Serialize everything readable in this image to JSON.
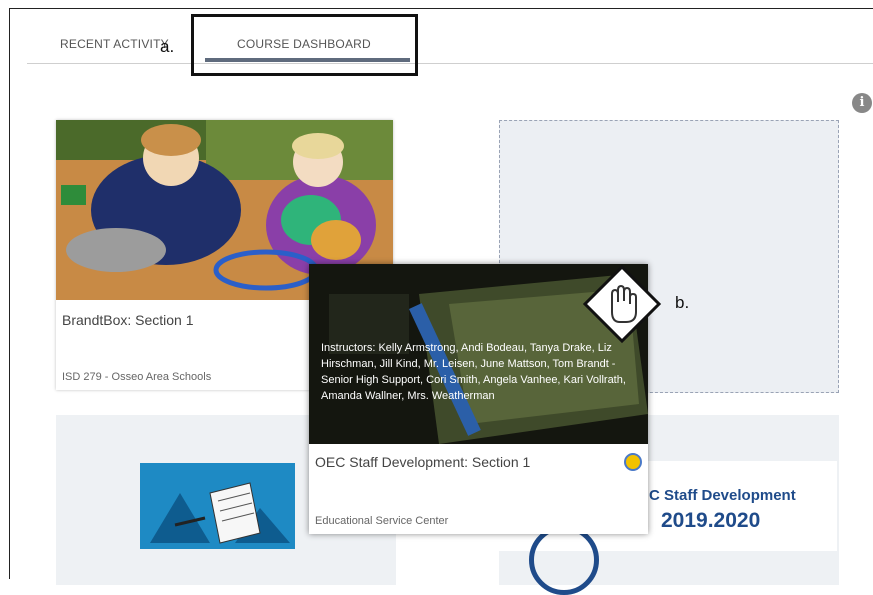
{
  "tabs": {
    "recent_activity": "RECENT ACTIVITY",
    "course_dashboard": "COURSE DASHBOARD"
  },
  "annotations": {
    "a": "a.",
    "b": "b."
  },
  "info_icon": {
    "glyph": "i",
    "icon": "info-icon"
  },
  "cards": {
    "brandtbox": {
      "title": "BrandtBox: Section 1",
      "subtitle": "ISD 279 - Osseo Area Schools"
    },
    "oec": {
      "title": "OEC Staff Development: Section 1",
      "subtitle": "Educational Service Center",
      "instructors": "Instructors: Kelly Armstrong, Andi Bodeau, Tanya Drake, Liz Hirschman, Jill Kind, Mr. Leisen, June Mattson, Tom Brandt - Senior High Support, Cori Smith, Angela Vanhee, Kari Vollrath, Amanda Wallner, Mrs. Weatherman"
    },
    "staff_dev_logo": {
      "line1": "C Staff Development",
      "line2": "2019.2020"
    }
  },
  "colors": {
    "tab_underline": "#5f6b7d",
    "brand_blue": "#1f4b8a",
    "badge_yellow": "#f2c200"
  }
}
